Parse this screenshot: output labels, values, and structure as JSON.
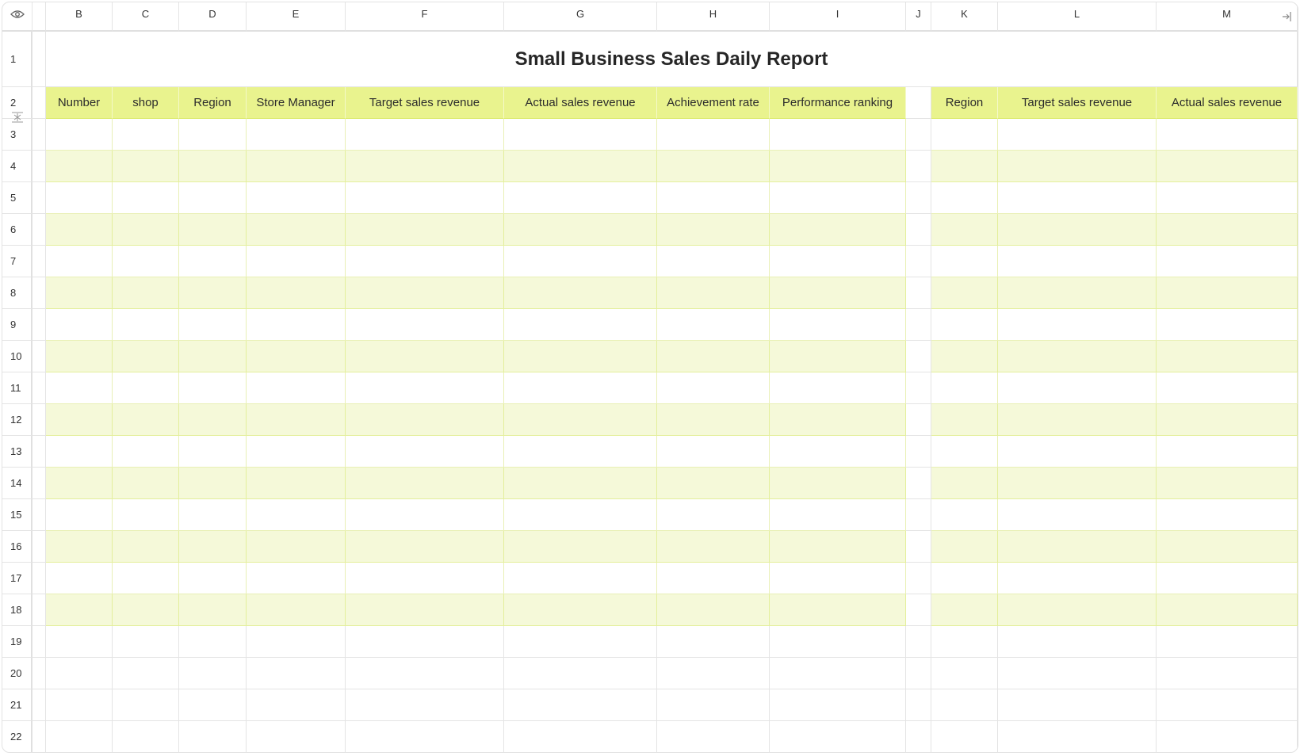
{
  "columns": [
    "B",
    "C",
    "D",
    "E",
    "F",
    "G",
    "H",
    "I",
    "J",
    "K",
    "L",
    "M"
  ],
  "rows": [
    "1",
    "2",
    "3",
    "4",
    "5",
    "6",
    "7",
    "8",
    "9",
    "10",
    "11",
    "12",
    "13",
    "14",
    "15",
    "16",
    "17",
    "18",
    "19",
    "20",
    "21",
    "22"
  ],
  "title": "Small Business Sales Daily Report",
  "headers_left": [
    "Number",
    "shop",
    "Region",
    "Store Manager",
    "Target sales revenue",
    "Actual sales revenue",
    "Achievement rate",
    "Performance ranking"
  ],
  "headers_right": [
    "Region",
    "Target sales revenue",
    "Actual sales revenue"
  ],
  "icons": {
    "corner": "eye-icon",
    "freeze": "freeze-pane-icon",
    "expand": "expand-arrow-icon"
  },
  "colors": {
    "header_fill": "#e9f38e",
    "band_fill": "#f5f9d9"
  }
}
